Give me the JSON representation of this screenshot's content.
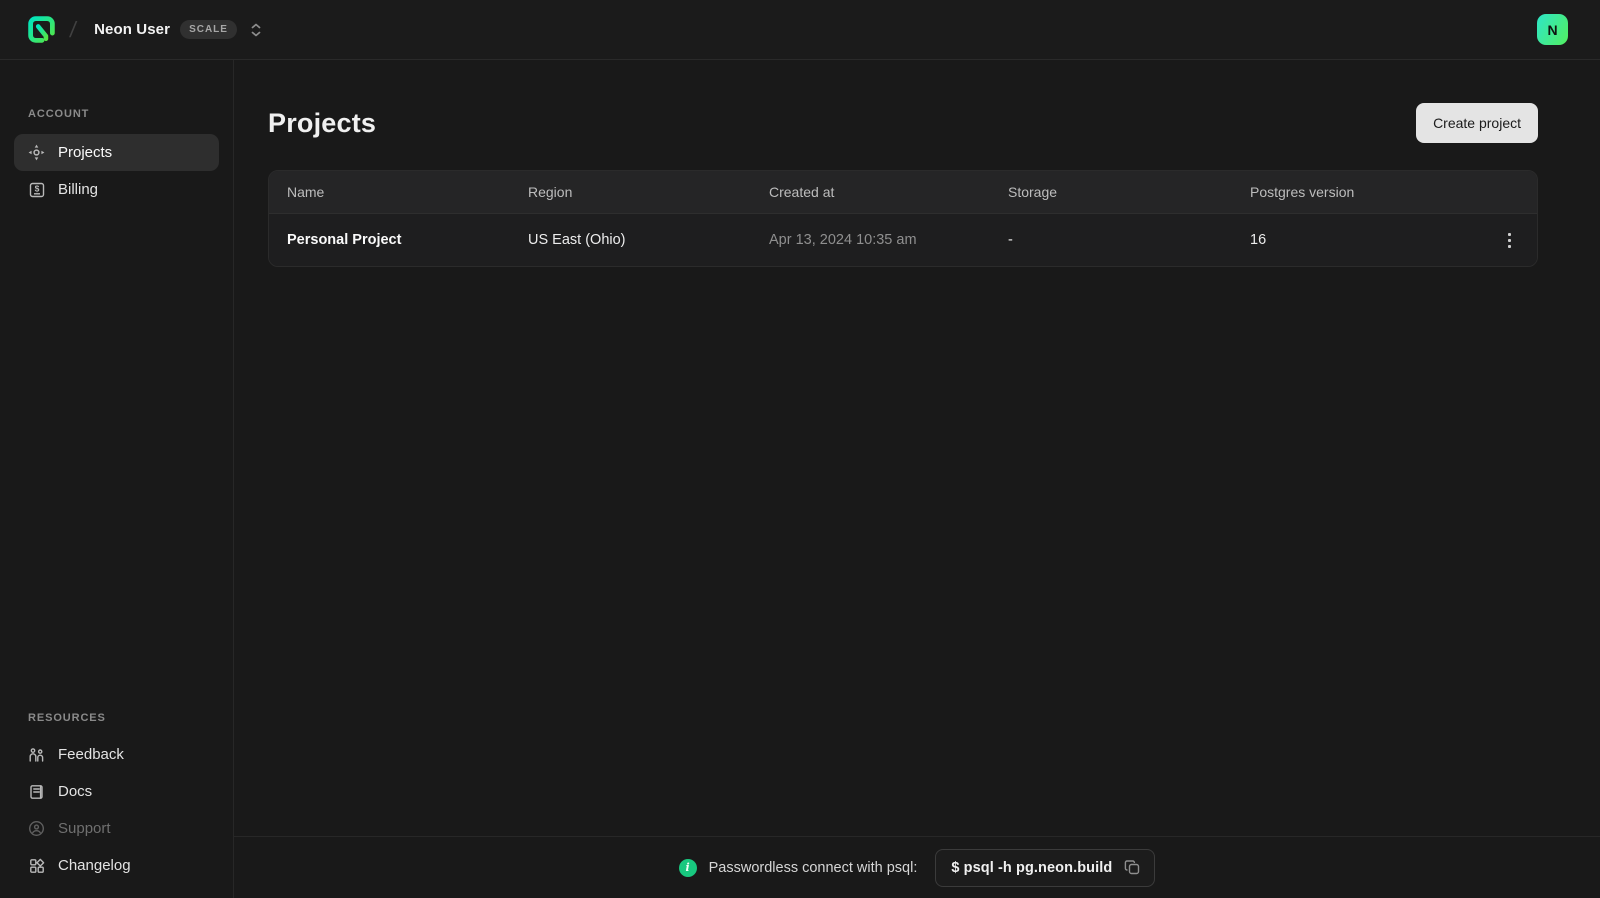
{
  "topbar": {
    "org_name": "Neon User",
    "plan_badge": "SCALE",
    "avatar_letter": "N"
  },
  "sidebar": {
    "account_section": "ACCOUNT",
    "account_items": [
      {
        "label": "Projects",
        "icon": "compass-icon",
        "active": true
      },
      {
        "label": "Billing",
        "icon": "dollar-square-icon",
        "active": false
      }
    ],
    "resources_section": "RESOURCES",
    "resource_items": [
      {
        "label": "Feedback",
        "icon": "people-icon",
        "dimmed": false
      },
      {
        "label": "Docs",
        "icon": "document-icon",
        "dimmed": false
      },
      {
        "label": "Support",
        "icon": "lifebuoy-icon",
        "dimmed": true
      },
      {
        "label": "Changelog",
        "icon": "grid-icon",
        "dimmed": false
      }
    ]
  },
  "main": {
    "title": "Projects",
    "create_button": "Create project",
    "table": {
      "columns": [
        "Name",
        "Region",
        "Created at",
        "Storage",
        "Postgres version"
      ],
      "rows": [
        {
          "name": "Personal Project",
          "region": "US East (Ohio)",
          "created_at": "Apr 13, 2024 10:35 am",
          "storage": "-",
          "postgres_version": "16"
        }
      ]
    }
  },
  "footer": {
    "info_icon": "i",
    "label": "Passwordless connect with psql:",
    "command": "$ psql -h pg.neon.build"
  },
  "colors": {
    "accent_green": "#00e599",
    "avatar_gradient_start": "#2ee6c8",
    "avatar_gradient_end": "#52ef5f",
    "page_background": "#191919",
    "table_header_background": "#252526",
    "selected_item_background": "#2e2e2e",
    "create_button_background": "#e4e4e4",
    "info_icon_background": "#18c87f"
  }
}
